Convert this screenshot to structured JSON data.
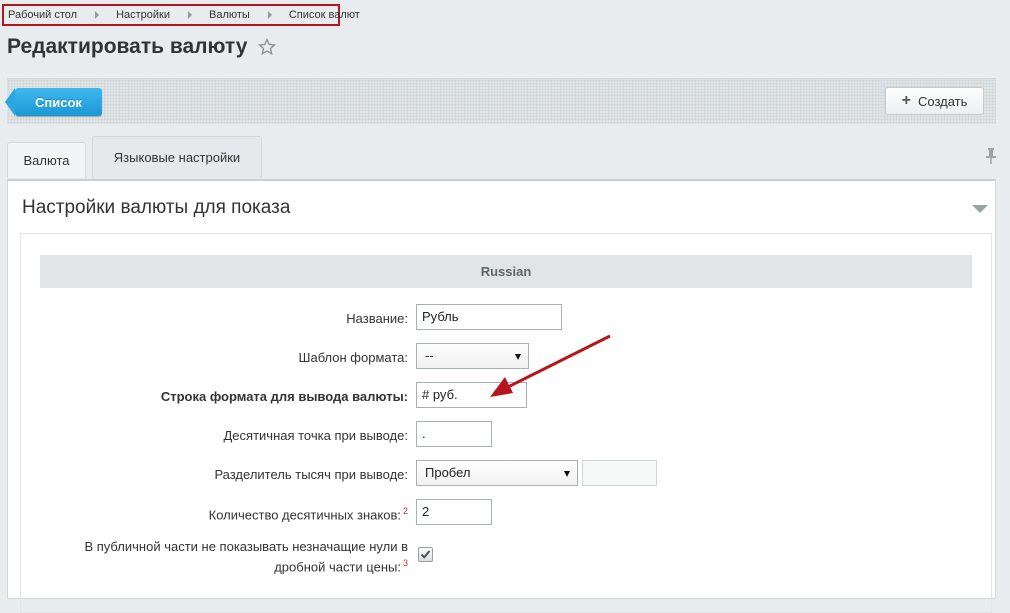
{
  "breadcrumb": [
    "Рабочий стол",
    "Настройки",
    "Валюты",
    "Список валют"
  ],
  "page_title": "Редактировать валюту",
  "toolbar": {
    "list_label": "Список",
    "create_label": "Создать"
  },
  "tabs": [
    {
      "label": "Валюта"
    },
    {
      "label": "Языковые настройки"
    }
  ],
  "section": {
    "title": "Настройки валюты для показа",
    "language": "Russian",
    "fields": {
      "name": {
        "label": "Название:",
        "value": "Рубль"
      },
      "template": {
        "label": "Шаблон формата:",
        "value": "--"
      },
      "format": {
        "label": "Строка формата для вывода валюты:",
        "value": "# руб."
      },
      "decimal_point": {
        "label": "Десятичная точка при выводе:",
        "value": "."
      },
      "thousands_sep": {
        "label": "Разделитель тысяч при выводе:",
        "value": "Пробел",
        "extra": ""
      },
      "decimals": {
        "label": "Количество десятичных знаков:",
        "note": "2",
        "value": "2"
      },
      "hide_zeros": {
        "label_line1": "В публичной части не показывать незначащие нули в",
        "label_line2": "дробной части цены:",
        "note": "3",
        "checked": true
      }
    }
  },
  "colors": {
    "accent": "#1b97d4",
    "highlight_border": "#b5161d",
    "arrow": "#b5161d"
  }
}
